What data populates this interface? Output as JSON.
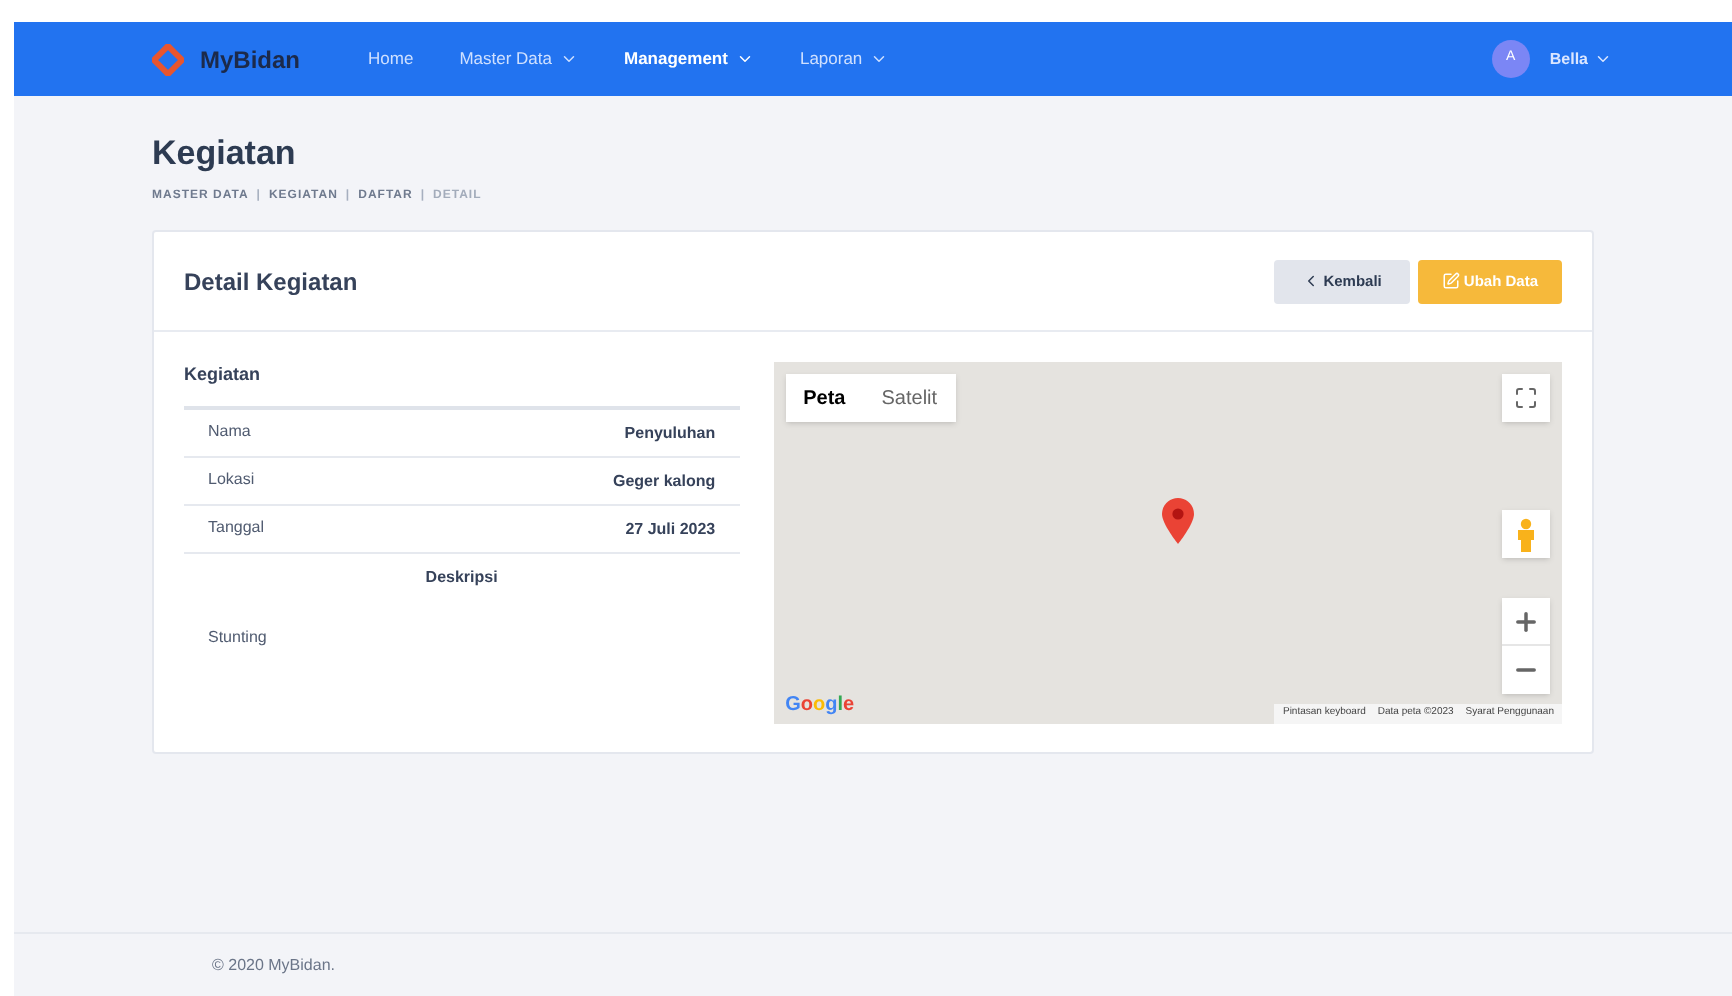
{
  "navbar": {
    "brand": "MyBidan",
    "menu": [
      {
        "label": "Home",
        "selected": false,
        "dropdown": false
      },
      {
        "label": "Master Data",
        "selected": false,
        "dropdown": true
      },
      {
        "label": "Management",
        "selected": true,
        "dropdown": true
      },
      {
        "label": "Laporan",
        "selected": false,
        "dropdown": true
      }
    ],
    "user": {
      "initial": "A",
      "name": "Bella"
    }
  },
  "page": {
    "title": "Kegiatan",
    "breadcrumb": [
      {
        "label": "MASTER DATA",
        "selected": false
      },
      {
        "label": "KEGIATAN",
        "selected": false
      },
      {
        "label": "DAFTAR",
        "selected": false
      },
      {
        "label": "DETAIL",
        "selected": true
      }
    ],
    "separator": "|"
  },
  "card": {
    "title": "Detail Kegiatan",
    "buttons": [
      {
        "label": "Kembali",
        "kind": "back"
      },
      {
        "label": "Ubah Data",
        "kind": "edit"
      }
    ],
    "section_title": "Kegiatan",
    "fields": [
      {
        "label": "Nama",
        "value": "Penyuluhan"
      },
      {
        "label": "Lokasi",
        "value": "Geger kalong"
      },
      {
        "label": "Tanggal",
        "value": "27 Juli 2023"
      }
    ],
    "description_title": "Deskripsi",
    "description": "Stunting"
  },
  "map": {
    "tabs": [
      {
        "label": "Peta",
        "selected": true
      },
      {
        "label": "Satelit",
        "selected": false
      }
    ],
    "logo": "Google",
    "attributions": [
      "Pintasan keyboard",
      "Data peta ©2023",
      "Syarat Penggunaan"
    ]
  },
  "footer": {
    "text": "© 2020 MyBidan."
  }
}
